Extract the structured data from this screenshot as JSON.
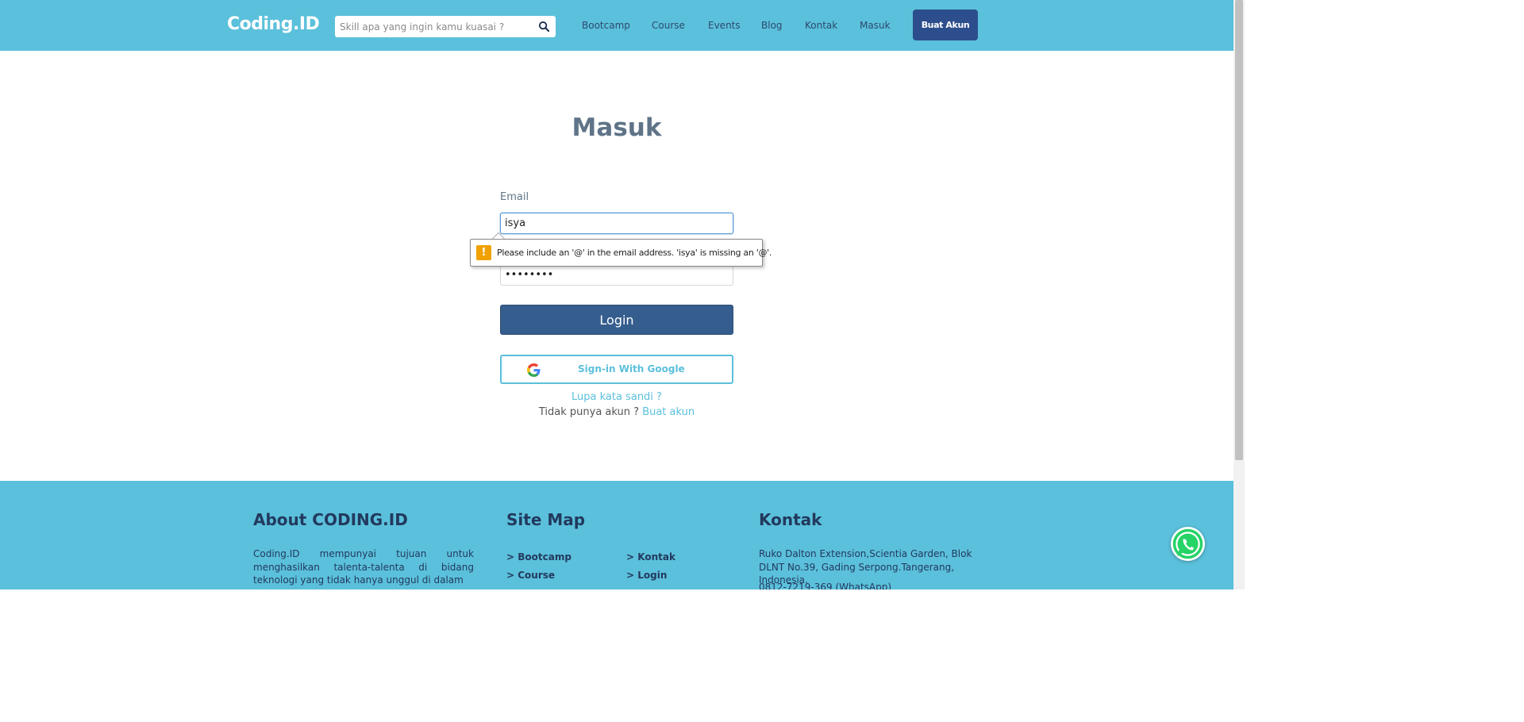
{
  "header": {
    "logo": "Coding.ID",
    "search_placeholder": "Skill apa yang ingin kamu kuasai ?",
    "nav": [
      "Bootcamp",
      "Course",
      "Events",
      "Blog",
      "Kontak",
      "Masuk"
    ],
    "signup_button": "Buat Akun"
  },
  "login": {
    "title": "Masuk",
    "email_label": "Email",
    "email_value": "isya",
    "password_value": "••••••••",
    "login_button": "Login",
    "google_button": "Sign-in With Google",
    "forgot_link": "Lupa kata sandi ?",
    "no_account_text": "Tidak punya akun ?",
    "create_account_link": "Buat akun"
  },
  "validation_tooltip": {
    "message": "Please include an '@' in the email address. 'isya' is missing an '@'."
  },
  "footer": {
    "about_title": "About CODING.ID",
    "about_text": "Coding.ID mempunyai tujuan untuk menghasilkan talenta-talenta di bidang teknologi yang tidak hanya unggul di dalam",
    "sitemap_title": "Site Map",
    "sitemap_links": [
      "Bootcamp",
      "Course",
      "Kontak",
      "Login"
    ],
    "contact_title": "Kontak",
    "address": "Ruko Dalton Extension,Scientia Garden, Blok DLNT No.39, Gading Serpong.Tangerang, Indonesia.",
    "phone": "0812-7219-369 (WhatsApp)"
  },
  "colors": {
    "brand": "#5bc0db",
    "primary_button": "#355d8e",
    "signup_button": "#2d4e8c",
    "warning": "#f0a202"
  },
  "icons": {
    "search": "search-icon",
    "google": "google-icon",
    "warning": "warning-icon",
    "whatsapp": "whatsapp-icon"
  }
}
